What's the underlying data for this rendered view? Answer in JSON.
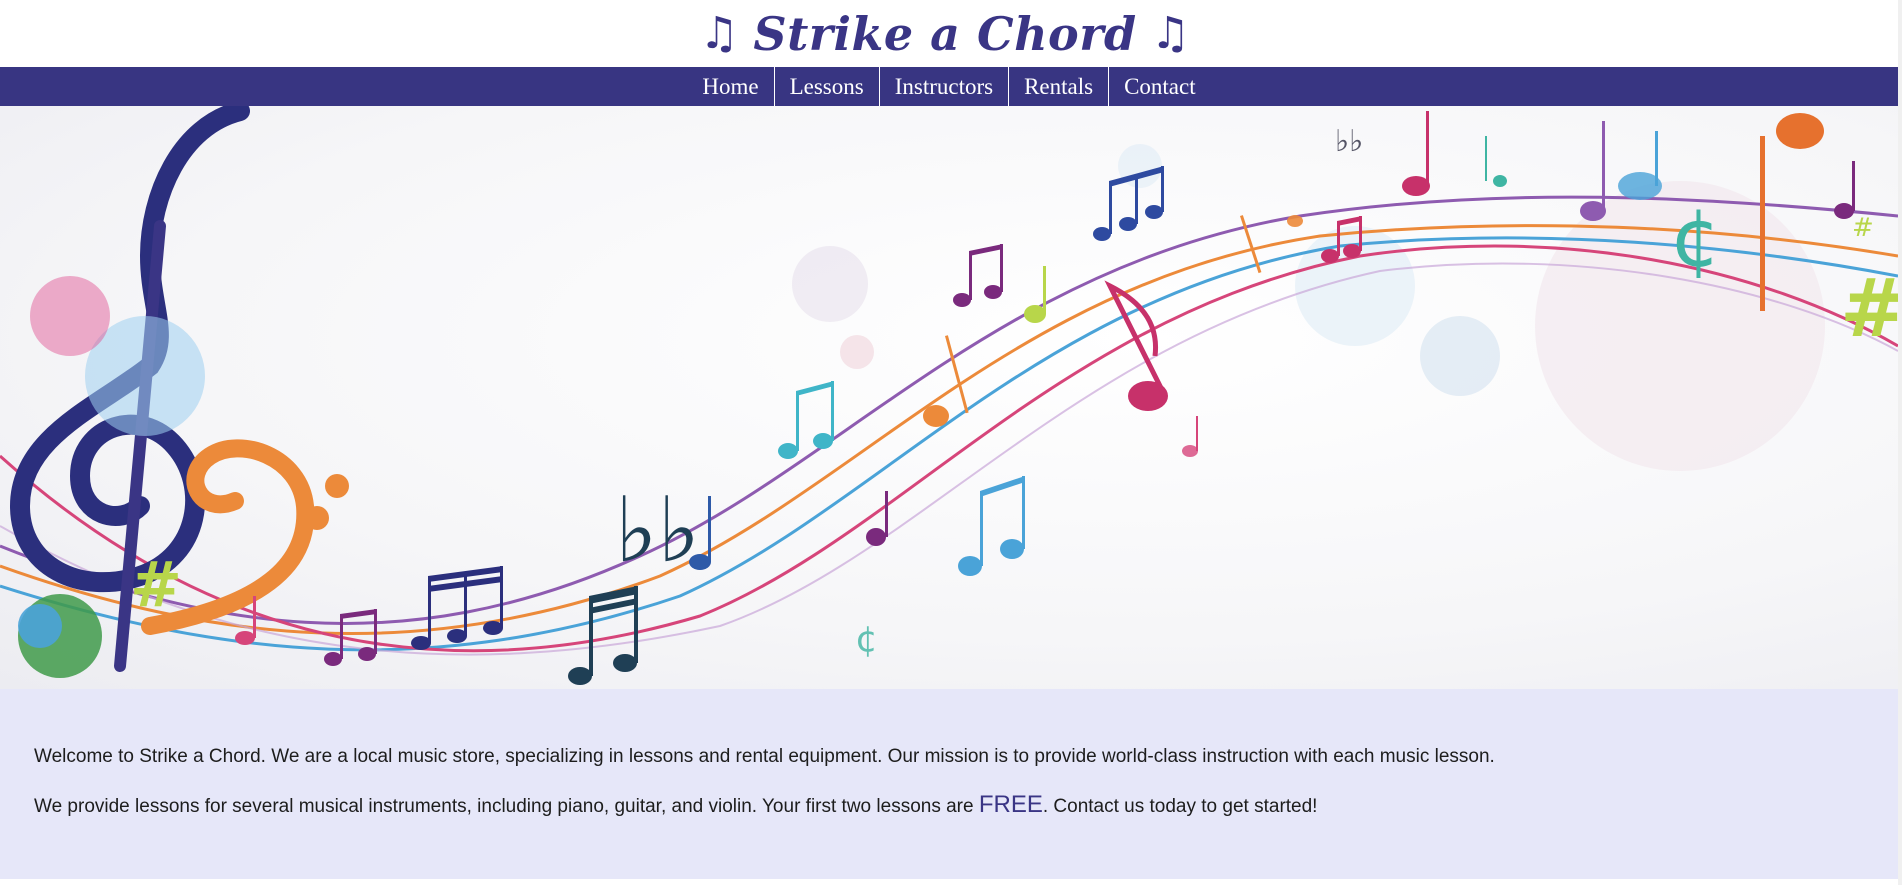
{
  "header": {
    "title": "Strike a Chord",
    "note_icon": "♫"
  },
  "nav": {
    "items": [
      {
        "label": "Home"
      },
      {
        "label": "Lessons"
      },
      {
        "label": "Instructors"
      },
      {
        "label": "Rentals"
      },
      {
        "label": "Contact"
      }
    ]
  },
  "hero": {
    "image": "colorful-music-notes-banner",
    "colors": {
      "purple": "#8e5bb0",
      "orange": "#ec8a3a",
      "blue": "#4aa3d8",
      "pink": "#d6457a",
      "green": "#b8d64a",
      "navy": "#2b2f7d",
      "teal": "#3fb5a3"
    }
  },
  "content": {
    "intro": "Welcome to Strike a Chord. We are a local music store, specializing in lessons and rental equipment. Our mission is to provide world-class instruction with each music lesson.",
    "lessons_before": "We provide lessons for several musical instruments, including piano, guitar, and violin. Your first two lessons are ",
    "lessons_free": "FREE",
    "lessons_after": ". Contact us today to get started!"
  },
  "colors": {
    "brand": "#3a3585",
    "nav_bg": "#383582",
    "content_bg": "#e6e7f9"
  }
}
